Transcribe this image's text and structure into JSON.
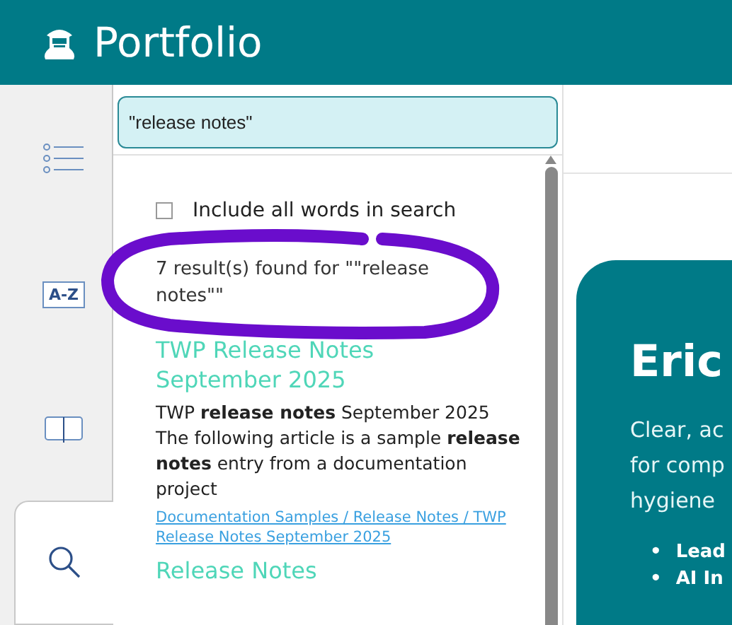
{
  "header": {
    "title": "Portfolio"
  },
  "sidebar": {
    "tabs": [
      {
        "kind": "contents",
        "selected": false
      },
      {
        "kind": "index",
        "label": "A-Z",
        "selected": false
      },
      {
        "kind": "glossary",
        "selected": false
      },
      {
        "kind": "search",
        "selected": true
      }
    ]
  },
  "search": {
    "value": "\"release notes\"",
    "all_words": {
      "label": "Include all words in search",
      "checked": false
    },
    "count": "7 result(s) found for \"\"release notes\"\"",
    "results": [
      {
        "title": "TWP Release Notes September 2025",
        "snippet": "TWP **release notes** September 2025 The following article is a sample **release notes** entry from a documentation project",
        "path": "Documentation Samples / Release Notes / TWP Release Notes September 2025"
      },
      {
        "title": "Release Notes"
      }
    ]
  },
  "annotation": {
    "kind": "scribble"
  },
  "content": {
    "heading": "Eric",
    "lines": [
      "Clear, ac",
      "for comp",
      "hygiene"
    ],
    "bullets": [
      {
        "marker": "•",
        "text": "Lead"
      },
      {
        "marker": "•",
        "text": "AI In"
      }
    ]
  }
}
